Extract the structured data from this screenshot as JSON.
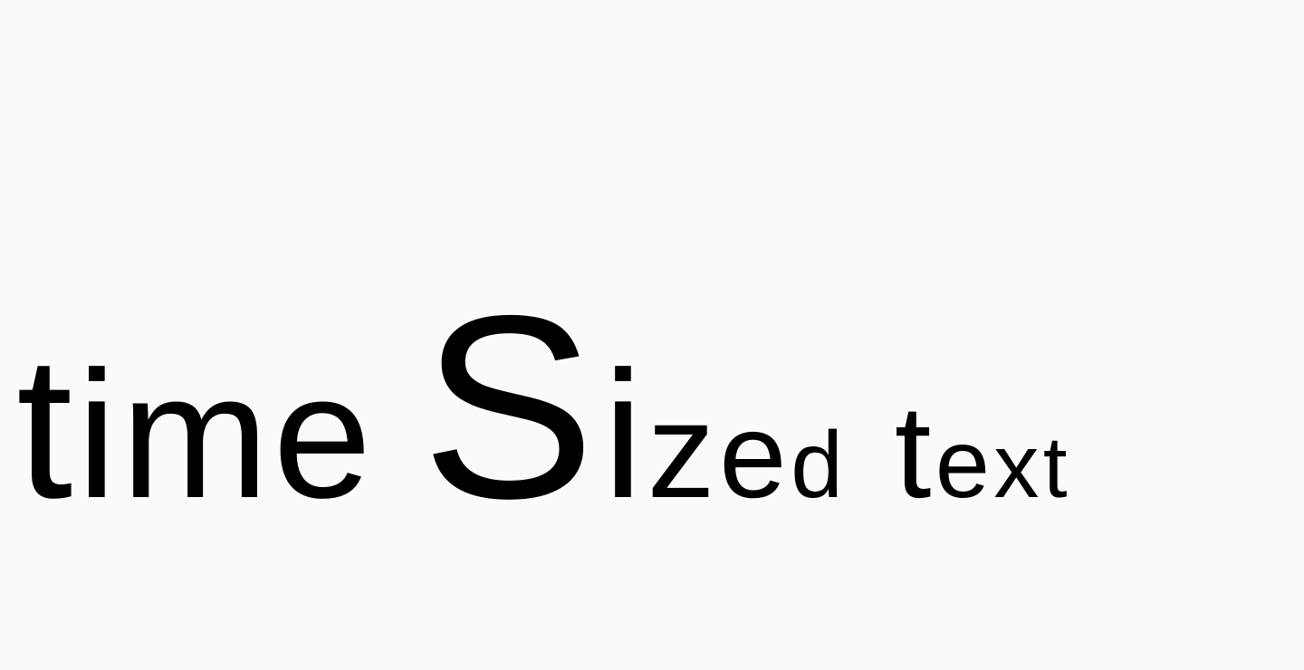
{
  "text": {
    "glyphs": [
      "t",
      "i",
      "m",
      "e",
      " ",
      "S",
      "i",
      "z",
      "e",
      "d",
      " ",
      "t",
      "e",
      "x",
      "t"
    ]
  },
  "colors": {
    "background": "#fafafa",
    "text": "#000000"
  }
}
